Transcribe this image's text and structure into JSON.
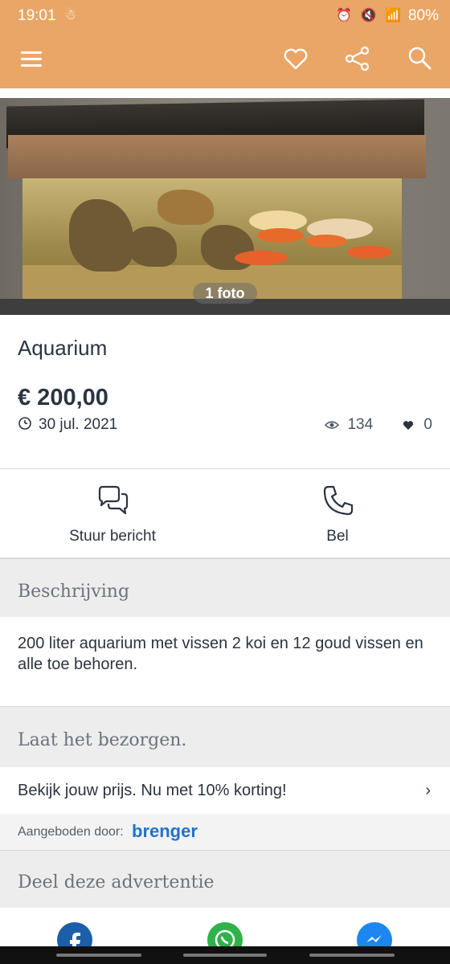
{
  "status_bar": {
    "time": "19:01",
    "icons": "⏰ 🔇 📶",
    "battery": "80%"
  },
  "app_bar": {
    "icons": [
      "menu-icon",
      "heart-icon",
      "share-icon",
      "search-icon"
    ]
  },
  "listing": {
    "photo_count": "1 foto",
    "title": "Aquarium",
    "price": "€ 200,00",
    "date": "30 jul. 2021",
    "views": "134",
    "likes": "0"
  },
  "actions": {
    "message_label": "Stuur bericht",
    "call_label": "Bel"
  },
  "description": {
    "heading": "Beschrijving",
    "text": "200 liter aquarium met vissen 2 koi en 12 goud vissen en alle toe behoren."
  },
  "delivery": {
    "heading": "Laat het bezorgen.",
    "promo": "Bekijk jouw prijs. Nu met 10% korting!",
    "offered_by": "Aangeboden door:",
    "brand": "brenger"
  },
  "share": {
    "heading": "Deel deze advertentie",
    "channels": [
      "facebook-icon",
      "whatsapp-icon",
      "messenger-icon"
    ]
  },
  "colors": {
    "accent": "#e9a666",
    "text": "#2b3440",
    "section_bg": "#ededed",
    "brand_blue": "#1f74c7"
  }
}
